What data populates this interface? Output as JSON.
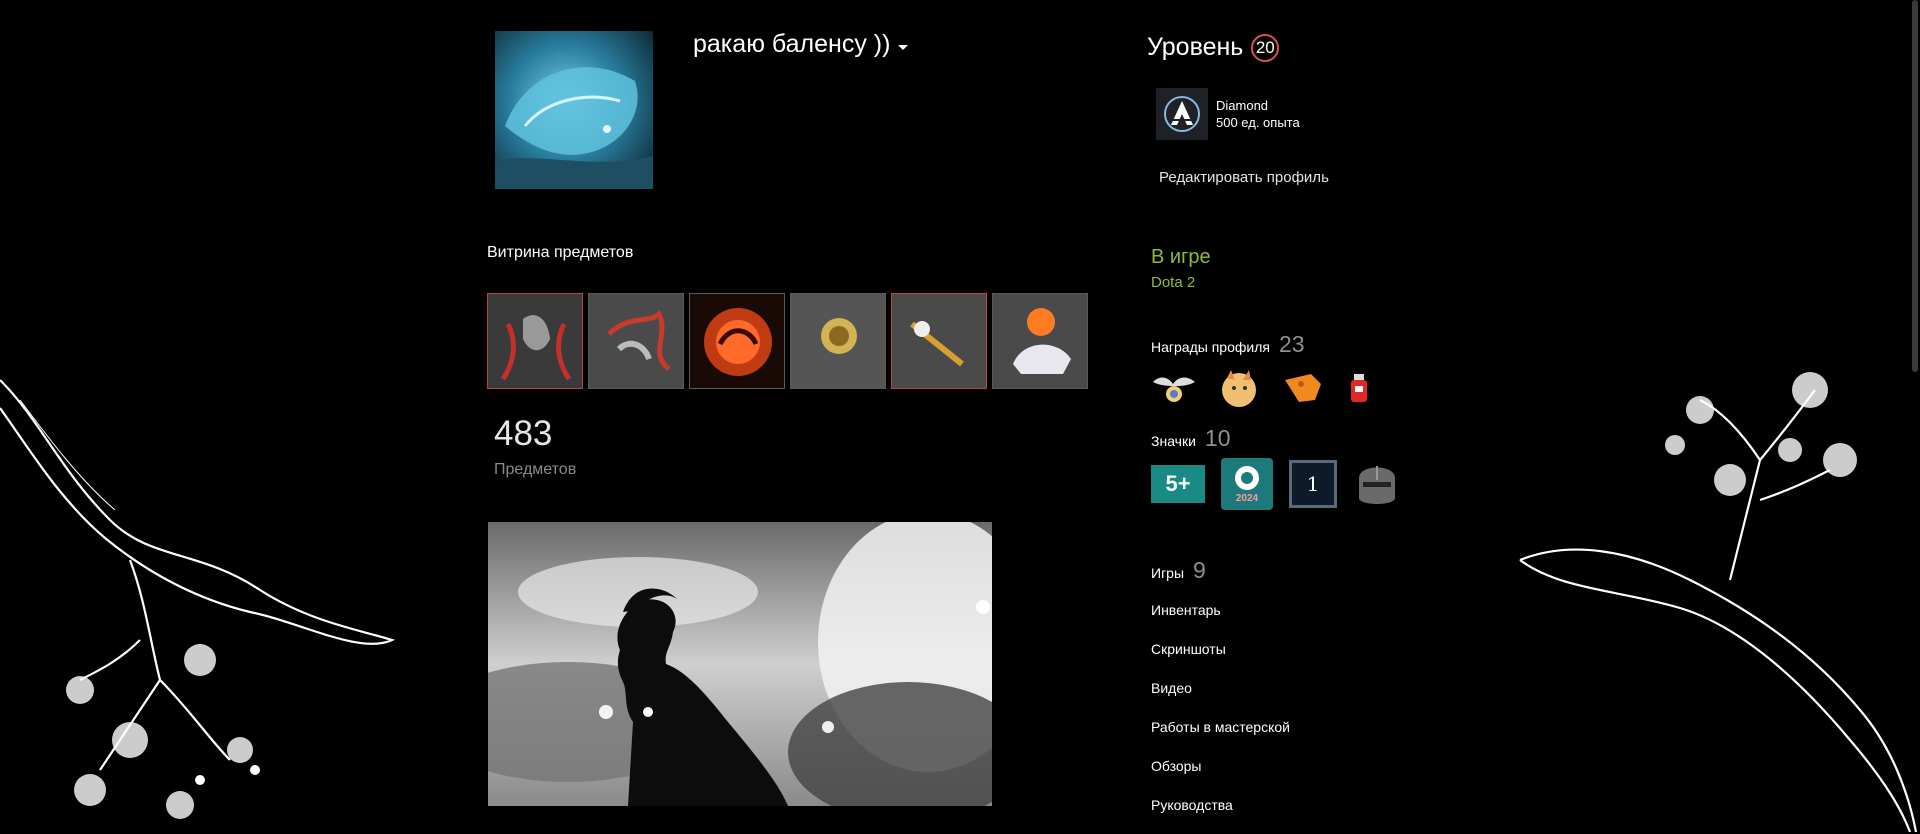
{
  "profile": {
    "persona_name": "ракаю баленсу ))",
    "edit_profile": "Редактировать профиль"
  },
  "level": {
    "label": "Уровень",
    "value": "20",
    "badge_name": "Diamond",
    "badge_xp": "500 ед. опыта"
  },
  "showcase": {
    "title": "Витрина предметов",
    "count": "483",
    "count_label": "Предметов"
  },
  "status": {
    "state": "В игре",
    "game": "Dota 2"
  },
  "awards": {
    "label": "Награды профиля",
    "count": "23"
  },
  "badges": {
    "label": "Значки",
    "count": "10",
    "items": [
      "5+",
      "2024",
      "1"
    ]
  },
  "games": {
    "label": "Игры",
    "count": "9"
  },
  "links": [
    "Инвентарь",
    "Скриншоты",
    "Видео",
    "Работы в мастерской",
    "Обзоры",
    "Руководства"
  ],
  "colors": {
    "background": "#000000",
    "in_game": "#90ba3c",
    "level_ring": "#d9534f",
    "muted": "#8f8f8f"
  }
}
